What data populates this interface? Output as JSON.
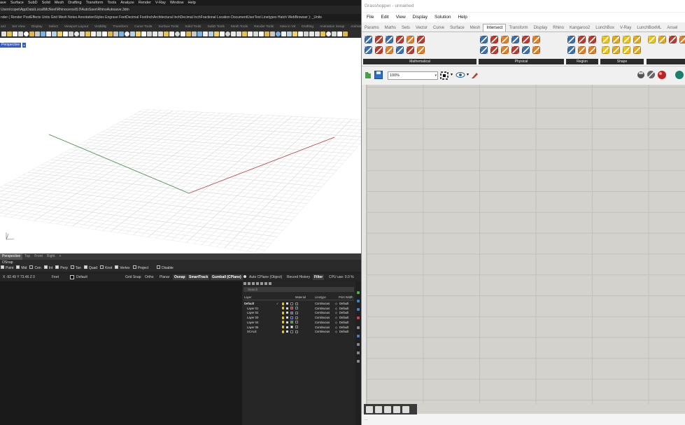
{
  "rhino": {
    "menubar": [
      "ave",
      "Surface",
      "SubD",
      "Solid",
      "Mesh",
      "Drafting",
      "Transform",
      "Tools",
      "Analyze",
      "Render",
      "V-Ray",
      "Window",
      "Help"
    ],
    "autosave_path": "Users\\copet\\AppData\\Local\\McNeel\\Rhinoceros\\8.0\\AutoSave\\RhinoAutosave.3dm",
    "command_line": "nder ( Render PostEffects Units Grid Mesh Notes AnnotationStyles Engrave FeetDecimal FootInchArchitectural InchDecimal InchFractional Location DocumentUserText Linetypes Hatch WebBrowser ): _Units",
    "toolbar_tabs": [
      "ard",
      "Set View",
      "Display",
      "Select",
      "Viewport Layout",
      "Visibility",
      "Transform",
      "Curve Tools",
      "Surface Tools",
      "Solid Tools",
      "SubD Tools",
      "Mesh Tools",
      "Render Tools",
      "New in V8",
      "Drafting",
      "Animation Setup",
      "Animation"
    ],
    "viewport_label": "Perspective",
    "viewport_tabs": [
      "Perspective",
      "Top",
      "Front",
      "Right",
      "+"
    ],
    "osnap_title": "OSnap",
    "osnap": [
      {
        "label": "Point",
        "checked": true
      },
      {
        "label": "Mid",
        "checked": true
      },
      {
        "label": "Cen",
        "checked": false
      },
      {
        "label": "Int",
        "checked": true
      },
      {
        "label": "Perp",
        "checked": true
      },
      {
        "label": "Tan",
        "checked": false
      },
      {
        "label": "Quad",
        "checked": true
      },
      {
        "label": "Knot",
        "checked": false
      },
      {
        "label": "Vertex",
        "checked": true
      },
      {
        "label": "Project",
        "checked": false
      },
      {
        "label": "Disable",
        "checked": false
      }
    ],
    "status": {
      "coords": "X -92.49 Y 73.46 Z 0",
      "units": "Feet",
      "layer": "Default",
      "grid_snap": "Grid Snap",
      "ortho": "Ortho",
      "planar": "Planar",
      "osnap": "Osnap",
      "smarttrack": "SmartTrack",
      "gumball": "Gumball (CPlane)",
      "auto_cplane": "Auto CPlane (Object)",
      "record_history": "Record History",
      "filter": "Filter",
      "cpu": "CPU use: 0.0 %"
    },
    "layers": {
      "search_placeholder": "Search",
      "headers": {
        "layer": "Layer",
        "material": "Material",
        "linetype": "Linetype",
        "print_width": "Print Width"
      },
      "rows": [
        {
          "name": "Default",
          "color": "#000000",
          "linetype": "Continuous",
          "print_width": "Default",
          "current": true
        },
        {
          "name": "Layer 01",
          "color": "#ff0000",
          "linetype": "Continuous",
          "print_width": "Default",
          "current": false
        },
        {
          "name": "Layer 02",
          "color": "#7f3fbf",
          "linetype": "Continuous",
          "print_width": "Default",
          "current": false
        },
        {
          "name": "Layer 03",
          "color": "#0000ff",
          "linetype": "Continuous",
          "print_width": "Default",
          "current": false
        },
        {
          "name": "Layer 04",
          "color": "#00c000",
          "linetype": "Continuous",
          "print_width": "Default",
          "current": false
        },
        {
          "name": "Layer 05",
          "color": "#ffffff",
          "linetype": "Continuous",
          "print_width": "Default",
          "current": false
        },
        {
          "name": "SCALE",
          "color": "#000000",
          "linetype": "Continuous",
          "print_width": "Default",
          "current": false
        }
      ]
    }
  },
  "grasshopper": {
    "title": "Grasshopper - unnamed",
    "menubar": [
      "File",
      "Edit",
      "View",
      "Display",
      "Solution",
      "Help"
    ],
    "tabs": [
      {
        "label": "Params",
        "active": false
      },
      {
        "label": "Maths",
        "active": false
      },
      {
        "label": "Sets",
        "active": false
      },
      {
        "label": "Vector",
        "active": false
      },
      {
        "label": "Curve",
        "active": false
      },
      {
        "label": "Surface",
        "active": false
      },
      {
        "label": "Mesh",
        "active": false
      },
      {
        "label": "Intersect",
        "active": true
      },
      {
        "label": "Transform",
        "active": false
      },
      {
        "label": "Display",
        "active": false
      },
      {
        "label": "Rhino",
        "active": false
      },
      {
        "label": "Kangaroo2",
        "active": false
      },
      {
        "label": "LunchBox",
        "active": false
      },
      {
        "label": "V-Ray",
        "active": false
      },
      {
        "label": "LunchBoxML",
        "active": false
      },
      {
        "label": "Ansel",
        "active": false
      }
    ],
    "ribbon_groups": [
      "Mathematical",
      "Physical",
      "Region",
      "Shape"
    ],
    "zoom": "100%",
    "status": "..."
  }
}
